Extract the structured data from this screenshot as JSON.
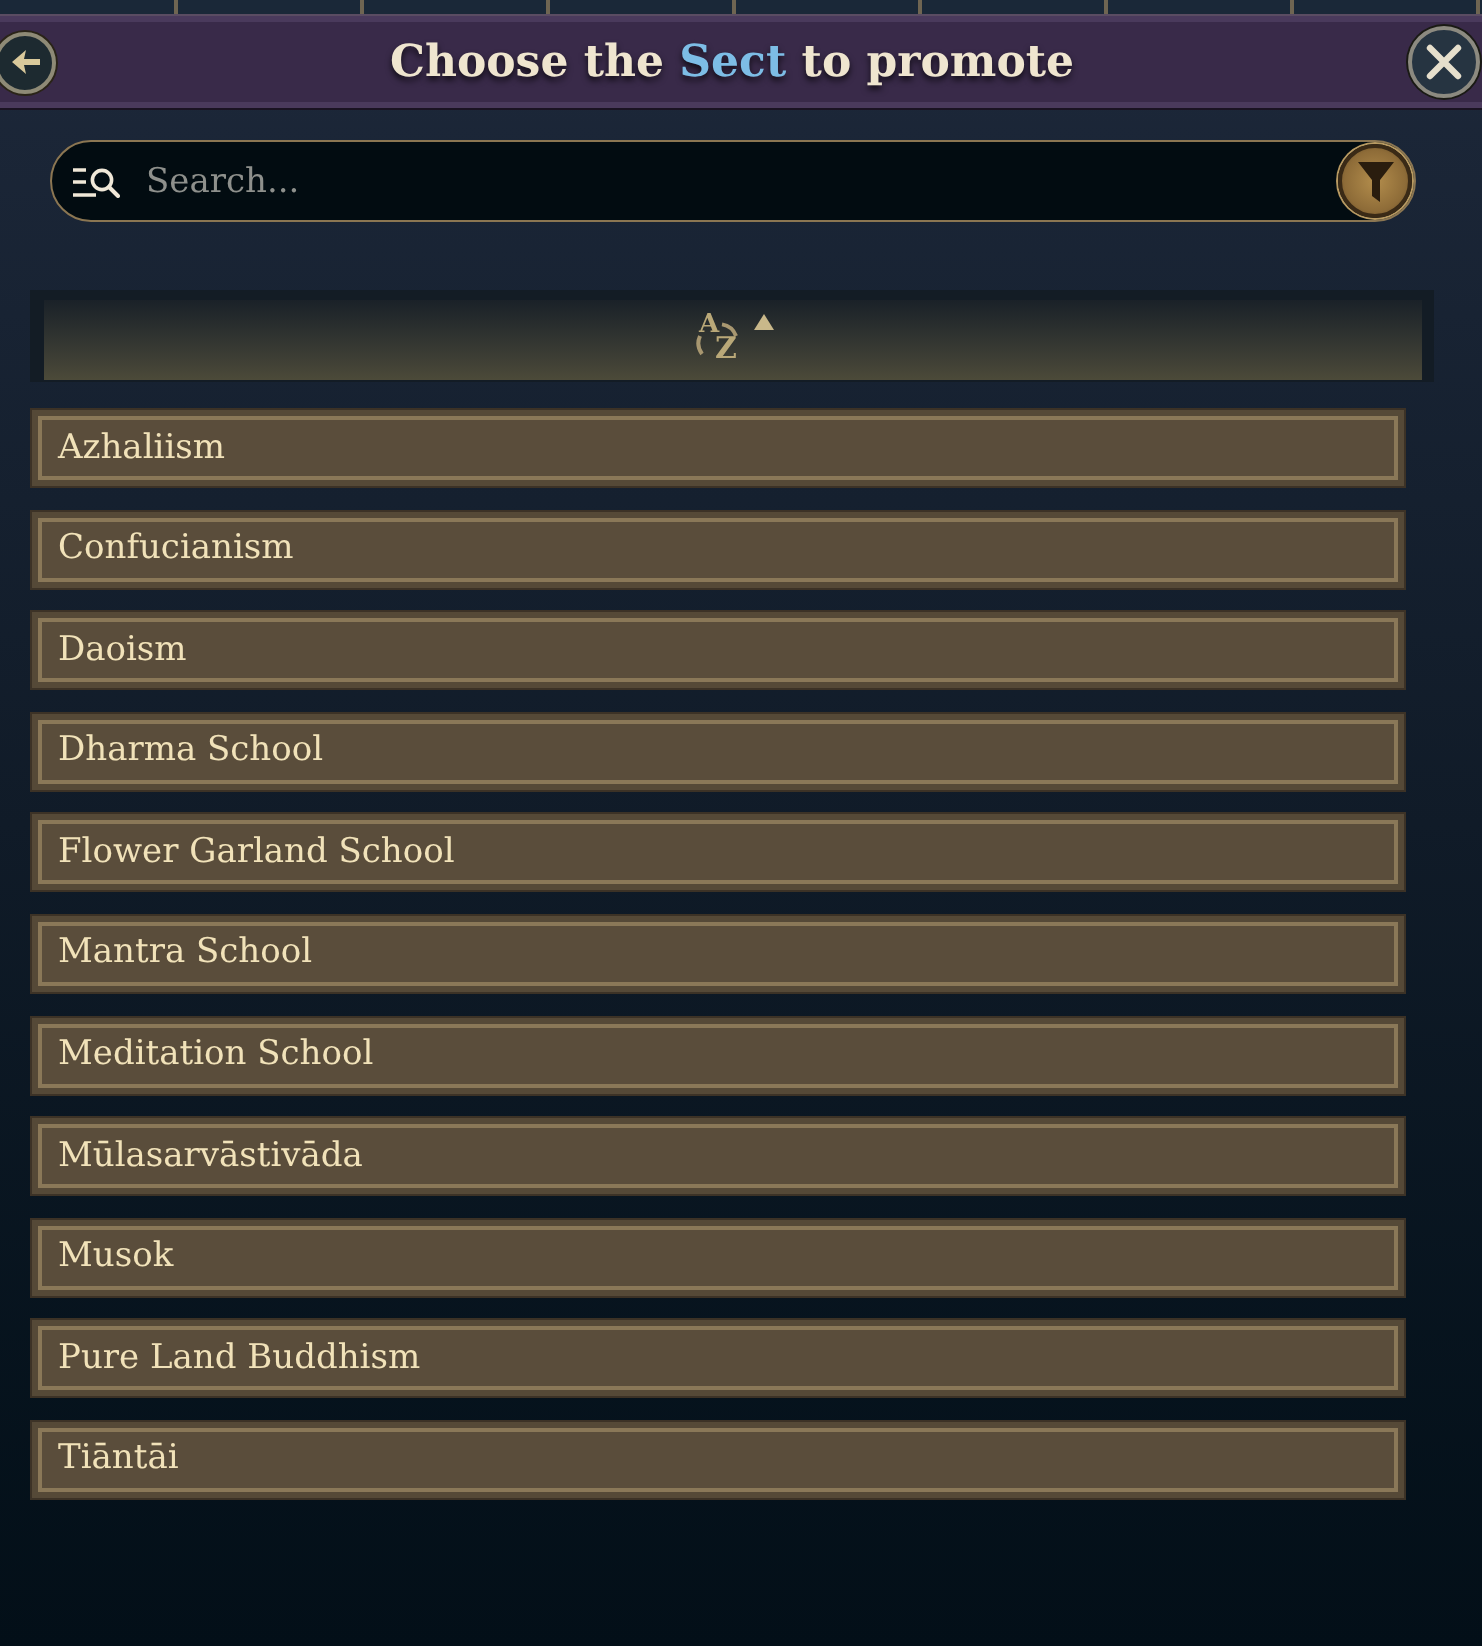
{
  "header": {
    "title": [
      {
        "text": "Choose the ",
        "highlight": false
      },
      {
        "text": "Sect",
        "highlight": true
      },
      {
        "text": " to promote",
        "highlight": false
      }
    ]
  },
  "search": {
    "placeholder": "Search..."
  },
  "sort": {
    "letters": [
      "A",
      "Z"
    ],
    "ascending": true
  },
  "sects": [
    {
      "label": "Azhaliism"
    },
    {
      "label": "Confucianism"
    },
    {
      "label": "Daoism"
    },
    {
      "label": "Dharma School"
    },
    {
      "label": "Flower Garland School"
    },
    {
      "label": "Mantra School"
    },
    {
      "label": "Meditation School"
    },
    {
      "label": "Mūlasarvāstivāda"
    },
    {
      "label": "Musok"
    },
    {
      "label": "Pure Land Buddhism"
    },
    {
      "label": "Tiāntāi"
    }
  ]
}
